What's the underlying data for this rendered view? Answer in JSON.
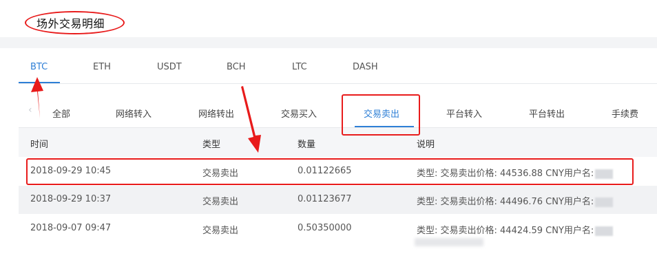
{
  "page": {
    "title": "场外交易明细"
  },
  "coin_tabs": [
    {
      "label": "BTC",
      "active": true
    },
    {
      "label": "ETH",
      "active": false
    },
    {
      "label": "USDT",
      "active": false
    },
    {
      "label": "BCH",
      "active": false
    },
    {
      "label": "LTC",
      "active": false
    },
    {
      "label": "DASH",
      "active": false
    }
  ],
  "type_tabs": [
    {
      "label": "全部",
      "active": false
    },
    {
      "label": "网络转入",
      "active": false
    },
    {
      "label": "网络转出",
      "active": false
    },
    {
      "label": "交易买入",
      "active": false
    },
    {
      "label": "交易卖出",
      "active": true
    },
    {
      "label": "平台转入",
      "active": false
    },
    {
      "label": "平台转出",
      "active": false
    },
    {
      "label": "手续费",
      "active": false
    }
  ],
  "table": {
    "headers": {
      "time": "时间",
      "type": "类型",
      "amount": "数量",
      "note": "说明"
    },
    "rows": [
      {
        "time": "2018-09-29 10:45",
        "type": "交易卖出",
        "amount": "0.01122665",
        "note": "类型: 交易卖出价格: 44536.88 CNY用户名:"
      },
      {
        "time": "2018-09-29 10:37",
        "type": "交易卖出",
        "amount": "0.01123677",
        "note": "类型: 交易卖出价格: 44496.76 CNY用户名:"
      },
      {
        "time": "2018-09-07 09:47",
        "type": "交易卖出",
        "amount": "0.50350000",
        "note": "类型: 交易卖出价格: 44424.59 CNY用户名:"
      }
    ]
  },
  "colors": {
    "accent": "#2e7fd6",
    "annotation": "#e81b1b"
  }
}
